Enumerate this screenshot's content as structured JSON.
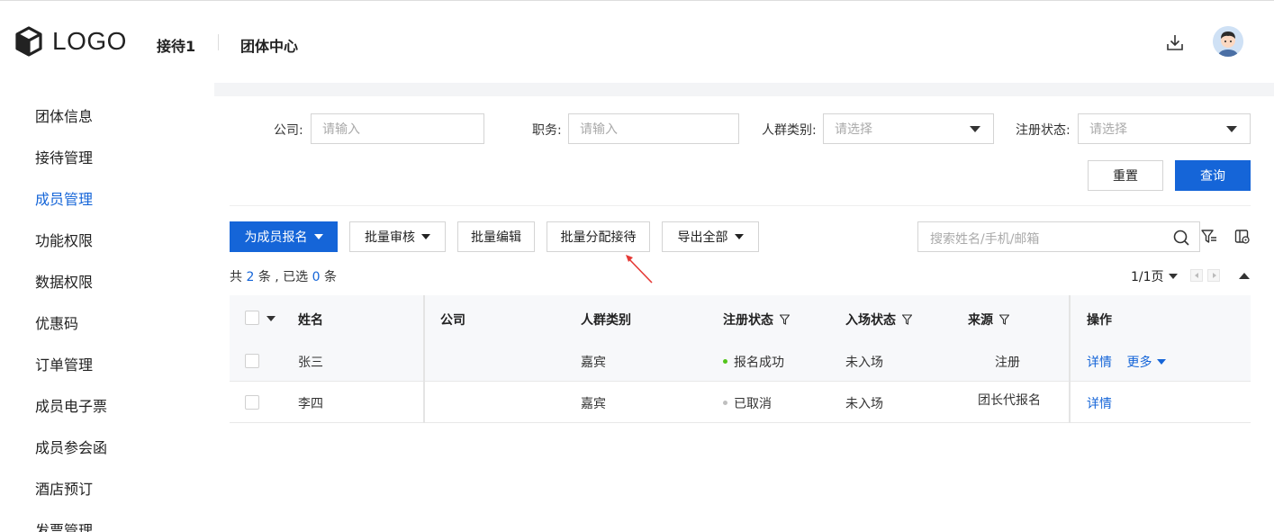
{
  "header": {
    "logo_text": "LOGO",
    "nav_1": "接待1",
    "nav_2": "团体中心",
    "download_icon": "download-icon",
    "avatar_icon": "user-avatar"
  },
  "sidebar": {
    "items": [
      {
        "label": "团体信息",
        "active": false
      },
      {
        "label": "接待管理",
        "active": false
      },
      {
        "label": "成员管理",
        "active": true
      },
      {
        "label": "功能权限",
        "active": false
      },
      {
        "label": "数据权限",
        "active": false
      },
      {
        "label": "优惠码",
        "active": false
      },
      {
        "label": "订单管理",
        "active": false
      },
      {
        "label": "成员电子票",
        "active": false
      },
      {
        "label": "成员参会函",
        "active": false
      },
      {
        "label": "酒店预订",
        "active": false
      },
      {
        "label": "发票管理",
        "active": false
      }
    ]
  },
  "filters": {
    "company_label": "公司:",
    "company_placeholder": "请输入",
    "position_label": "职务:",
    "position_placeholder": "请输入",
    "group_label": "人群类别:",
    "group_placeholder": "请选择",
    "reg_status_label": "注册状态:",
    "reg_status_placeholder": "请选择",
    "reset_label": "重置",
    "query_label": "查询"
  },
  "toolbar": {
    "register_label": "为成员报名",
    "batch_review_label": "批量审核",
    "batch_edit_label": "批量编辑",
    "batch_assign_label": "批量分配接待",
    "export_label": "导出全部",
    "search_placeholder": "搜索姓名/手机/邮箱"
  },
  "summary": {
    "prefix": "共",
    "total": "2",
    "mid": "条 , 已选",
    "selected": "0",
    "suffix": "条",
    "page_text": "1/1页"
  },
  "table": {
    "columns": {
      "name": "姓名",
      "company": "公司",
      "group": "人群类别",
      "reg_status": "注册状态",
      "entry_status": "入场状态",
      "source": "来源",
      "actions": "操作"
    },
    "rows": [
      {
        "name": "张三",
        "company": "",
        "group": "嘉宾",
        "reg_status": "报名成功",
        "status_color": "#52c41a",
        "entry_status": "未入场",
        "source": "注册",
        "detail": "详情",
        "more": "更多"
      },
      {
        "name": "李四",
        "company": "",
        "group": "嘉宾",
        "reg_status": "已取消",
        "status_color": "#bfbfbf",
        "entry_status": "未入场",
        "source": "团长代报名",
        "detail": "详情",
        "more": ""
      }
    ]
  },
  "colors": {
    "accent": "#1565d8",
    "annotation_arrow": "#e53935"
  }
}
